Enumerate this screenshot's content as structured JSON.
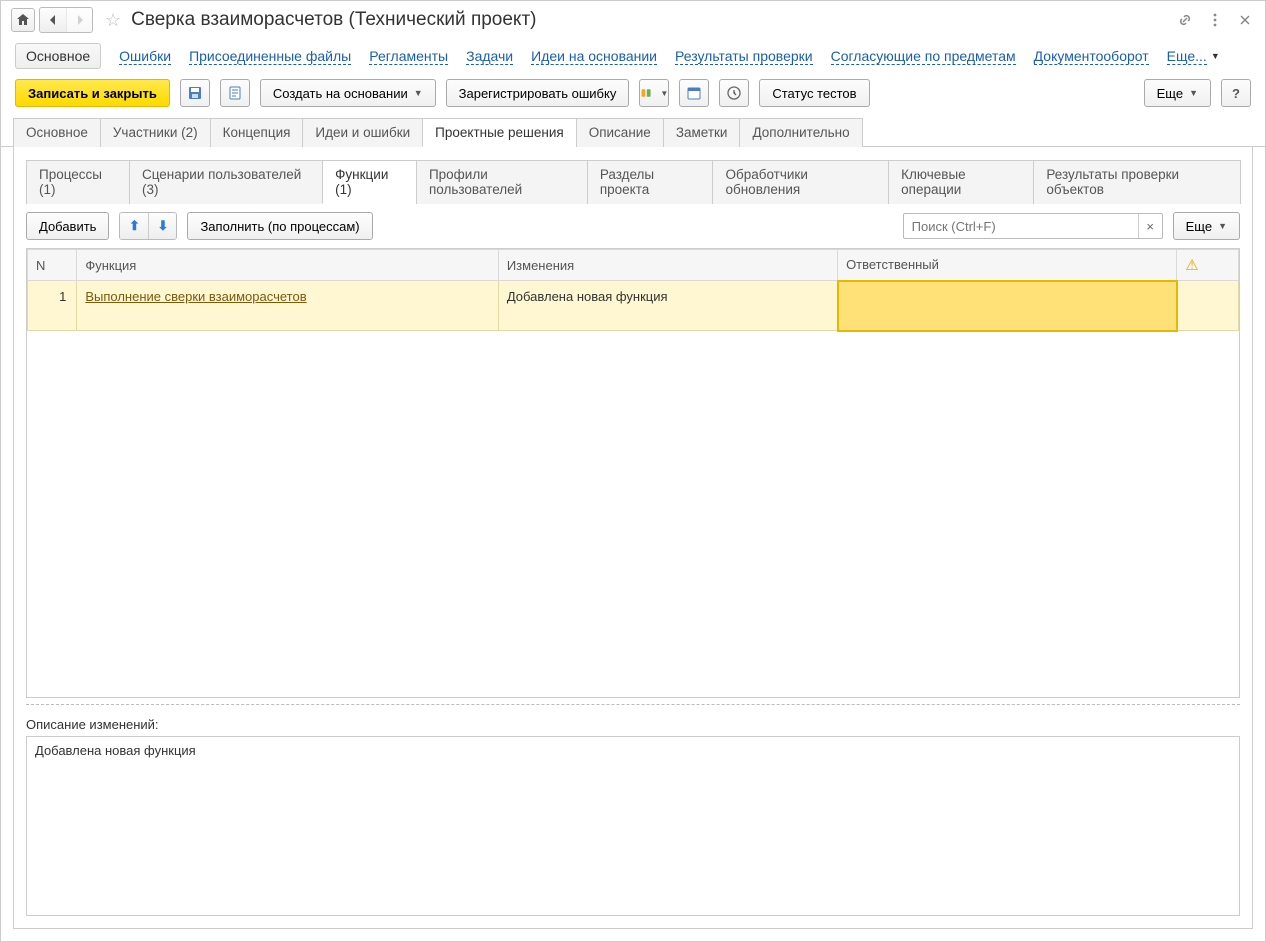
{
  "title": "Сверка взаиморасчетов (Технический проект)",
  "navlinks": {
    "active": "Основное",
    "links": [
      "Ошибки",
      "Присоединенные файлы",
      "Регламенты",
      "Задачи",
      "Идеи на основании",
      "Результаты проверки",
      "Согласующие по предметам",
      "Документооборот"
    ],
    "more": "Еще..."
  },
  "toolbar": {
    "save_close": "Записать и закрыть",
    "create_based": "Создать на основании",
    "register_error": "Зарегистрировать ошибку",
    "tests_status": "Статус тестов",
    "more": "Еще",
    "help": "?"
  },
  "tabs_main": [
    "Основное",
    "Участники (2)",
    "Концепция",
    "Идеи и ошибки",
    "Проектные решения",
    "Описание",
    "Заметки",
    "Дополнительно"
  ],
  "tabs_main_active": 4,
  "tabs_inner": [
    "Процессы (1)",
    "Сценарии пользователей (3)",
    "Функции (1)",
    "Профили пользователей",
    "Разделы проекта",
    "Обработчики обновления",
    "Ключевые операции",
    "Результаты проверки объектов"
  ],
  "tabs_inner_active": 2,
  "inner_toolbar": {
    "add": "Добавить",
    "fill": "Заполнить (по процессам)",
    "search_placeholder": "Поиск (Ctrl+F)",
    "more": "Еще"
  },
  "table": {
    "columns": {
      "n": "N",
      "func": "Функция",
      "changes": "Изменения",
      "responsible": "Ответственный"
    },
    "rows": [
      {
        "n": "1",
        "func": "Выполнение сверки взаиморасчетов",
        "changes": "Добавлена новая функция",
        "responsible": ""
      }
    ]
  },
  "description": {
    "label": "Описание изменений:",
    "text": "Добавлена новая функция"
  }
}
